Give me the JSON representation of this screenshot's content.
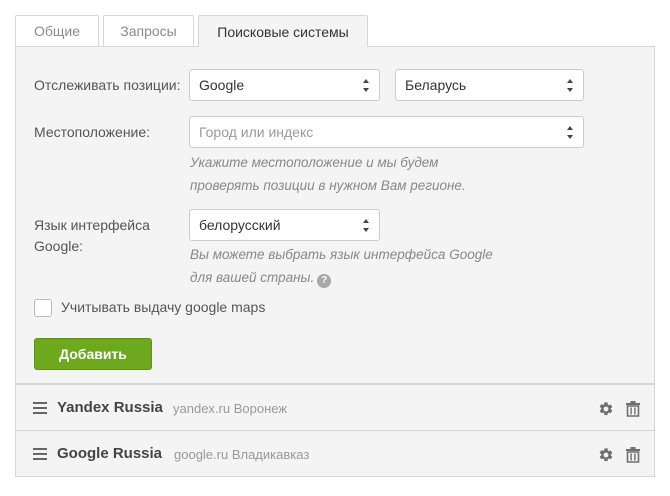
{
  "tabs": [
    {
      "label": "Общие"
    },
    {
      "label": "Запросы"
    },
    {
      "label": "Поисковые системы"
    }
  ],
  "form": {
    "track_label": "Отслеживать позиции:",
    "engine": {
      "value": "Google"
    },
    "country": {
      "value": "Беларусь"
    },
    "location_label": "Местоположение:",
    "location": {
      "placeholder": "Город или индекс"
    },
    "location_hint_1": "Укажите местоположение и мы будем",
    "location_hint_2": "проверять позиции в нужном Вам регионе.",
    "lang_label_1": "Язык интерфейса",
    "lang_label_2": "Google:",
    "language": {
      "value": "белорусский"
    },
    "lang_hint_1": "Вы можете выбрать язык интерфейса Google",
    "lang_hint_2": "для вашей страны.",
    "help_glyph": "?",
    "maps_checkbox": {
      "label": "Учитывать выдачу google maps",
      "checked": false
    },
    "add_button": "Добавить"
  },
  "engines": [
    {
      "name": "Yandex Russia",
      "details": "yandex.ru Воронеж"
    },
    {
      "name": "Google Russia",
      "details": "google.ru Владикавказ"
    }
  ],
  "colors": {
    "accent": "#6ea81f",
    "panel_bg": "#f4f4f4",
    "border": "#d6d6d6",
    "hint": "#888888"
  }
}
